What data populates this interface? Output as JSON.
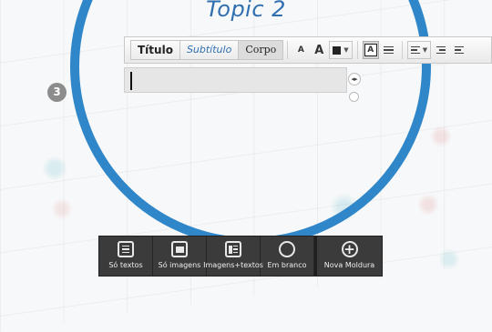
{
  "topic": {
    "title": "Topic 2",
    "step_number": "3",
    "accent_color": "#2f86c8"
  },
  "toolbar": {
    "styles": [
      "Título",
      "Subtítulo",
      "Corpo"
    ],
    "selected_style": "Corpo",
    "font_smaller": "A",
    "font_larger": "A",
    "highlight_glyph": "A",
    "icons": [
      "font-size-smaller-icon",
      "font-size-larger-icon",
      "text-color-icon",
      "highlight-icon",
      "bulleted-list-icon",
      "align-icon",
      "indent-decrease-icon",
      "indent-increase-icon"
    ]
  },
  "text_field": {
    "value": ""
  },
  "frame_bar": {
    "items": [
      {
        "label": "Só textos",
        "icon": "text-frame-icon"
      },
      {
        "label": "Só imagens",
        "icon": "image-frame-icon"
      },
      {
        "label": "Imagens+textos",
        "icon": "image-text-frame-icon"
      },
      {
        "label": "Em branco",
        "icon": "blank-frame-icon"
      },
      {
        "label": "Nova Moldura",
        "icon": "new-frame-plus-icon"
      }
    ]
  }
}
